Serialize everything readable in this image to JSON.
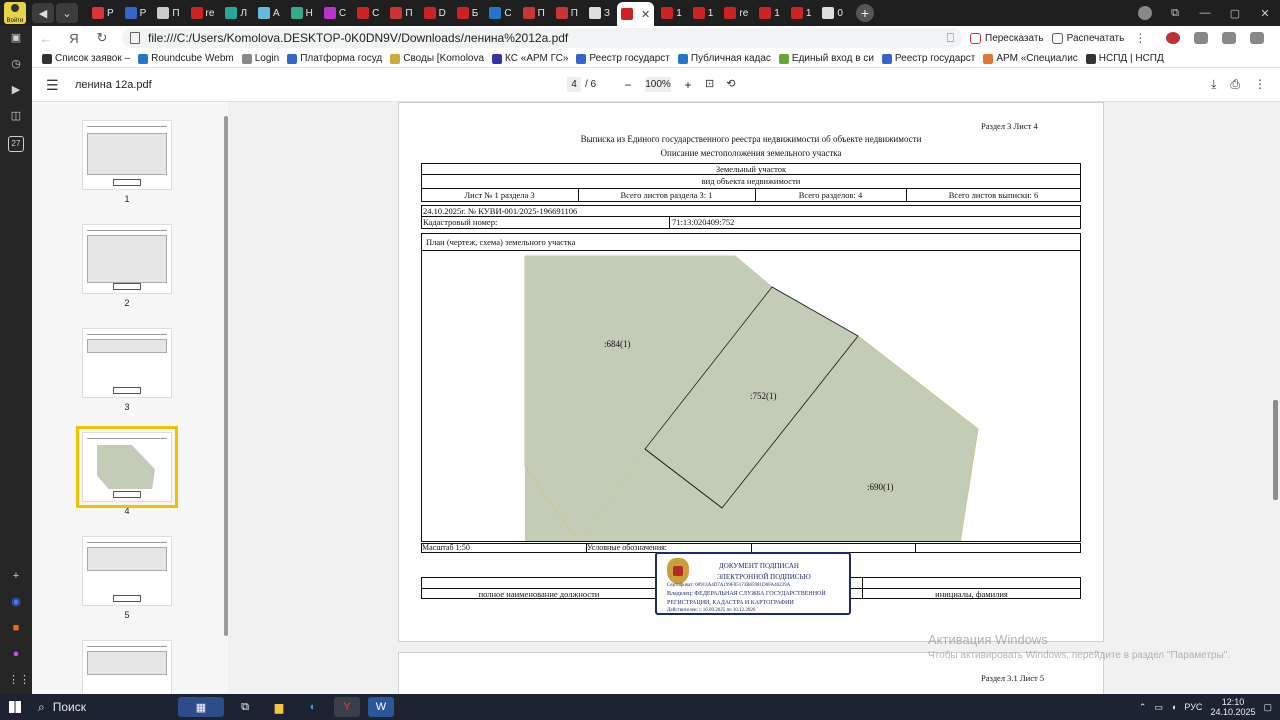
{
  "browser": {
    "avatar_label": "Войти",
    "tabs": [
      {
        "label": "Р",
        "color": "#d33"
      },
      {
        "label": "Р",
        "color": "#36c"
      },
      {
        "label": "П",
        "color": "#ccc"
      },
      {
        "label": "re",
        "color": "#c22"
      },
      {
        "label": "Л",
        "color": "#2a9"
      },
      {
        "label": "А",
        "color": "#6bd"
      },
      {
        "label": "Н",
        "color": "#3a8"
      },
      {
        "label": "С",
        "color": "#b3c"
      },
      {
        "label": "С",
        "color": "#c22"
      },
      {
        "label": "П",
        "color": "#c33"
      },
      {
        "label": "D",
        "color": "#c22"
      },
      {
        "label": "Б",
        "color": "#c22"
      },
      {
        "label": "С",
        "color": "#27c"
      },
      {
        "label": "П",
        "color": "#c33"
      },
      {
        "label": "П",
        "color": "#c33"
      },
      {
        "label": "З",
        "color": "#ddd"
      }
    ],
    "active_tab": {
      "label": "",
      "color": "#c22"
    },
    "tail_tabs": [
      {
        "label": "1",
        "color": "#c22"
      },
      {
        "label": "1",
        "color": "#c22"
      },
      {
        "label": "re",
        "color": "#c22"
      },
      {
        "label": "1",
        "color": "#c22"
      },
      {
        "label": "1",
        "color": "#c22"
      },
      {
        "label": "0",
        "color": "#ddd"
      }
    ],
    "url": "file:///C:/Users/Komolova.DESKTOP-0K0DN9V/Downloads/ленина%2012a.pdf",
    "translate_label": "Пересказать",
    "print_label": "Распечатать",
    "bookmarks": [
      {
        "label": "Список заявок –",
        "color": "#333"
      },
      {
        "label": "Roundcube Webm",
        "color": "#27c"
      },
      {
        "label": "Login",
        "color": "#888"
      },
      {
        "label": "Платформа госуд",
        "color": "#36c"
      },
      {
        "label": "Своды [Komolova",
        "color": "#ca3"
      },
      {
        "label": "КС «АРМ ГС»",
        "color": "#33a"
      },
      {
        "label": "Реестр государст",
        "color": "#36c"
      },
      {
        "label": "Публичная кадас",
        "color": "#27c"
      },
      {
        "label": "Единый вход в си",
        "color": "#6a3"
      },
      {
        "label": "Реестр государст",
        "color": "#36c"
      },
      {
        "label": "АРМ «Специалис",
        "color": "#d73"
      },
      {
        "label": "НСПД | НСПД",
        "color": "#333"
      }
    ],
    "sidebar_badge": "27"
  },
  "pdf": {
    "file_name": "ленина 12а.pdf",
    "page_current": "4",
    "page_total": "/ 6",
    "zoom": "100%",
    "thumbnails": [
      {
        "num": "1"
      },
      {
        "num": "2"
      },
      {
        "num": "3"
      },
      {
        "num": "4"
      },
      {
        "num": "5"
      },
      {
        "num": ""
      }
    ]
  },
  "document": {
    "header_right": "Раздел 3   Лист 4",
    "title": "Выписка из Единого государственного реестра недвижимости об объекте недвижимости",
    "subtitle": "Описание местоположения земельного участка",
    "object_type": "Земельный участок",
    "object_type_caption": "вид объекта недвижимости",
    "sheet_info": [
      "Лист № 1 раздела 3",
      "Всего листов раздела 3: 1",
      "Всего разделов: 4",
      "Всего листов выписки: 6"
    ],
    "extract_number": "24.10.2025г. № КУВИ-001/2025-196691106",
    "cadastral_label": "Кадастровый номер:",
    "cadastral_number": "71:13:020409:752",
    "plan_title": "План (чертеж, схема) земельного участка",
    "parcel_labels": [
      ":684(1)",
      ":752(1)",
      ":690(1)"
    ],
    "scale": "Масштаб 1:50",
    "legend_label": "Условные обозначения:",
    "footer_position": "полное наименование должности",
    "footer_name": "инициалы, фамилия",
    "next_page_header": "Раздел 3.1 Лист 5",
    "signature": {
      "line1": "ДОКУМЕНТ ПОДПИСАН",
      "line2": "ЭЛЕКТРОННОЙ ПОДПИСЬЮ",
      "cert": "Сертификат: 00913A4D7A199F05173B65981D0FA40239A",
      "owner": "Владелец: ФЕДЕРАЛЬНАЯ СЛУЖБА ГОСУДАРСТВЕННОЙ",
      "owner2": "РЕГИСТРАЦИИ, КАДАСТРА И КАРТОГРАФИИ",
      "valid": "Действителен: с 16.09.2025 по 10.12.2026"
    }
  },
  "watermark": {
    "line1": "Активация Windows",
    "line2": "Чтобы активировать Windows, перейдите в раздел \"Параметры\"."
  },
  "taskbar": {
    "search_label": "Поиск",
    "lang": "РУС",
    "time": "12:10",
    "date": "24.10.2025"
  }
}
